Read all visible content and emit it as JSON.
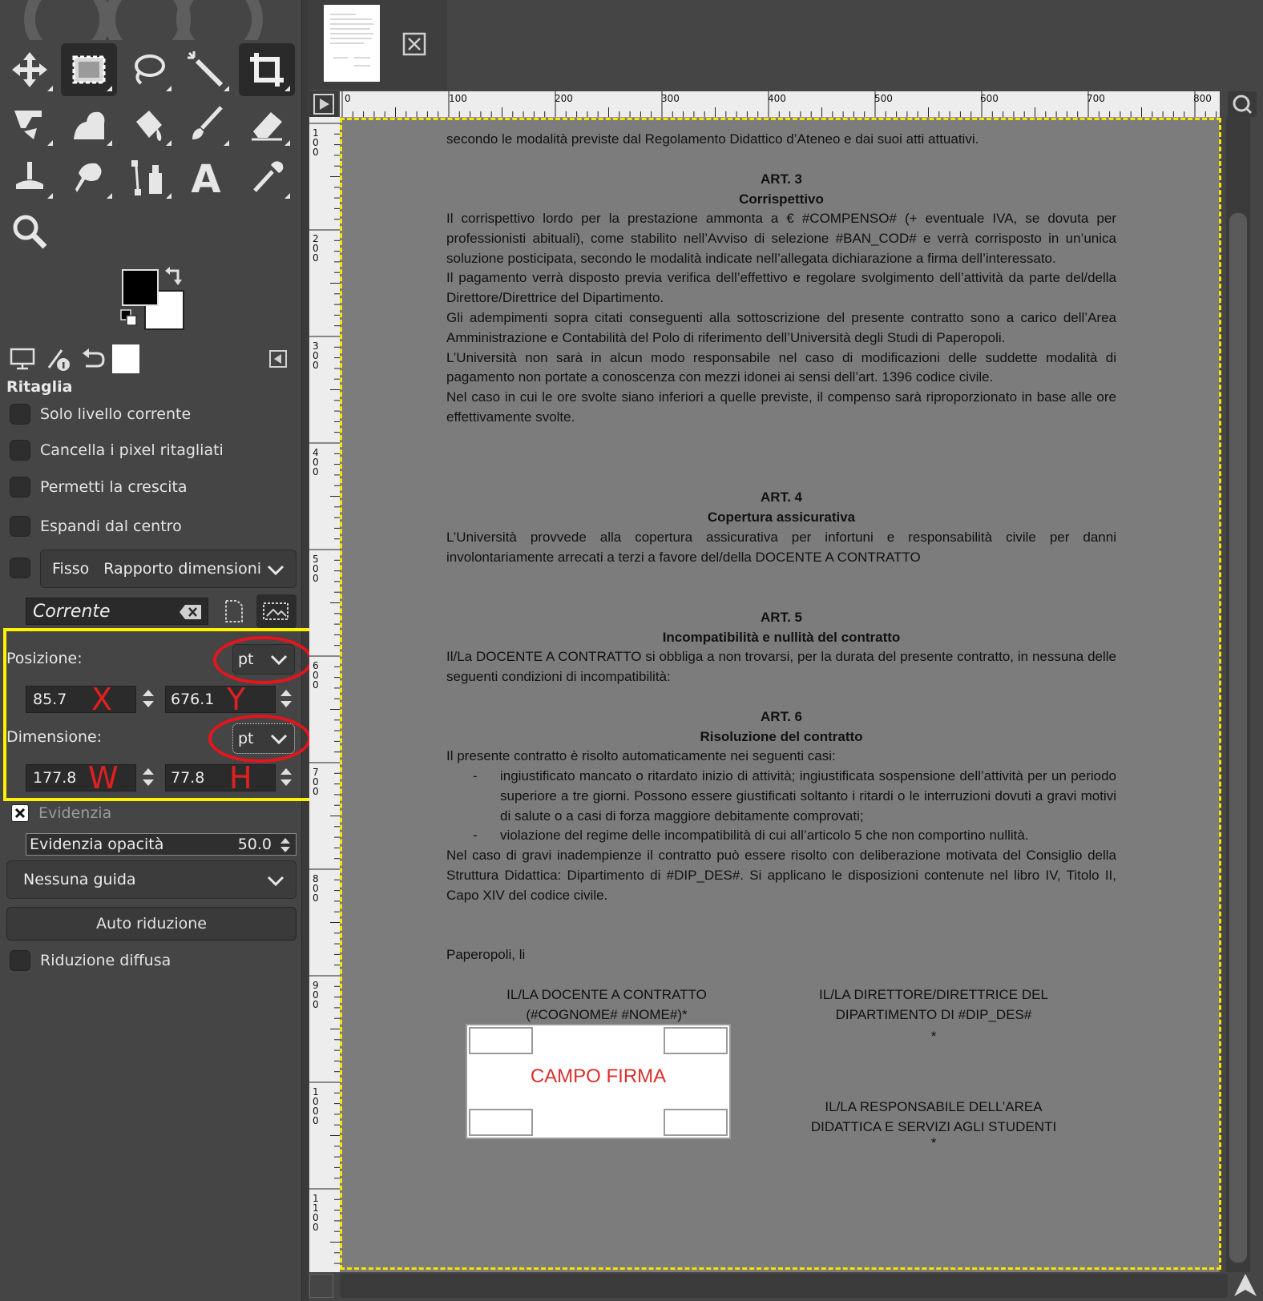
{
  "tool_options": {
    "title": "Ritaglia",
    "options": [
      {
        "label": "Solo livello corrente",
        "checked": false
      },
      {
        "label": "Cancella i pixel ritagliati",
        "checked": false
      },
      {
        "label": "Permetti la crescita",
        "checked": false
      },
      {
        "label": "Espandi dal centro",
        "checked": false
      }
    ],
    "fixed_label": "Fisso",
    "fixed_mode": "Rapporto dimensioni",
    "aspect_value": "Corrente",
    "position": {
      "label": "Posizione:",
      "unit": "pt",
      "x": "85.7",
      "y": "676.1",
      "x_letter": "X",
      "y_letter": "Y"
    },
    "size": {
      "label": "Dimensione:",
      "unit": "pt",
      "w": "177.8",
      "h": "77.8",
      "w_letter": "W",
      "h_letter": "H"
    },
    "highlight_label": "Evidenzia",
    "highlight_opacity_label": "Evidenzia opacità",
    "highlight_opacity_value": "50.0",
    "guides": "Nessuna guida",
    "auto_shrink": "Auto riduzione",
    "shrink_merged": "Riduzione diffusa"
  },
  "ruler_top": [
    "0",
    "100",
    "200",
    "300",
    "400",
    "500",
    "600",
    "700",
    "800"
  ],
  "ruler_left": [
    "1\n0\n0",
    "2\n0\n0",
    "3\n0\n0",
    "4\n0\n0",
    "5\n0\n0",
    "6\n0\n0",
    "7\n0\n0",
    "8\n0\n0",
    "9\n0\n0",
    "1\n0\n0\n0",
    "1\n1\n0\n0"
  ],
  "document": {
    "line0": "secondo le modalità previste dal Regolamento Didattico d’Ateneo e dai suoi atti attuativi.",
    "art3_title": "ART. 3",
    "art3_sub": "Corrispettivo",
    "art3_p1": "Il corrispettivo lordo per la prestazione ammonta a € #COMPENSO# (+ eventuale IVA, se dovuta  per professionisti abituali), come stabilito nell’Avviso di selezione #BAN_COD# e verrà corrisposto in un’unica soluzione posticipata, secondo le modalità indicate nell’allegata dichiarazione a firma dell’interessato.",
    "art3_p2": "Il pagamento verrà disposto previa verifica dell’effettivo e regolare svolgimento dell’attività da parte del/della Direttore/Direttrice del Dipartimento.",
    "art3_p3": "Gli adempimenti sopra citati conseguenti alla sottoscrizione del presente contratto sono a carico dell’Area Amministrazione e Contabilità del Polo di riferimento dell’Università degli Studi di Paperopoli.",
    "art3_p4": "L’Università non sarà in alcun modo responsabile nel caso di modificazioni delle suddette modalità di pagamento non portate a conoscenza con mezzi idonei ai sensi dell’art. 1396 codice civile.",
    "art3_p5": "Nel caso in cui le ore svolte siano inferiori a quelle previste, il compenso sarà riproporzionato in base alle ore effettivamente svolte.",
    "art4_title": "ART. 4",
    "art4_sub": "Copertura assicurativa",
    "art4_p1": "L’Università provvede alla copertura assicurativa per infortuni e responsabilità civile per danni involontariamente arrecati a terzi a favore del/della DOCENTE A CONTRATTO",
    "art5_title": "ART. 5",
    "art5_sub": "Incompatibilità e nullità del contratto",
    "art5_p1": "Il/La DOCENTE A CONTRATTO si obbliga a non trovarsi, per la durata del presente contratto, in nessuna delle seguenti condizioni di incompatibilità:",
    "art6_title": "ART. 6",
    "art6_sub": "Risoluzione del contratto",
    "art6_p1": "Il presente contratto è risolto automaticamente nei seguenti casi:",
    "art6_li1": "ingiustificato mancato o ritardato inizio di attività; ingiustificata sospensione dell’attività per un periodo superiore a tre giorni. Possono essere giustificati soltanto i ritardi o le interruzioni dovuti a gravi motivi di salute o a casi di forza maggiore debitamente comprovati;",
    "art6_li2": "violazione del regime delle incompatibilità di cui all’articolo 5 che non comportino nullità.",
    "art6_p2": "Nel caso di gravi inadempienze il contratto può essere risolto con deliberazione motivata del Consiglio della Struttura Didattica: Dipartimento di #DIP_DES#. Si applicano le disposizioni contenute nel libro IV, Titolo II, Capo XIV del codice civile.",
    "place": "Paperopoli, li",
    "sig_left_1": "IL/LA  DOCENTE A CONTRATTO",
    "sig_left_2": "(#COGNOME# #NOME#)*",
    "sig_right_1": "IL/LA  DIRETTORE/DIRETTRICE DEL",
    "sig_right_2": "DIPARTIMENTO DI #DIP_DES#",
    "sig_right_3": "*",
    "sig_right_4": "IL/LA RESPONSABILE DELL’AREA",
    "sig_right_5": "DIDATTICA E SERVIZI AGLI STUDENTI",
    "sig_right_6": "*",
    "campo_firma": "CAMPO FIRMA",
    "bullet": "-"
  },
  "colors": {
    "highlight_yellow": "#fff200",
    "annotation_red": "#e8141b",
    "campo_firma": "#d9302b"
  }
}
